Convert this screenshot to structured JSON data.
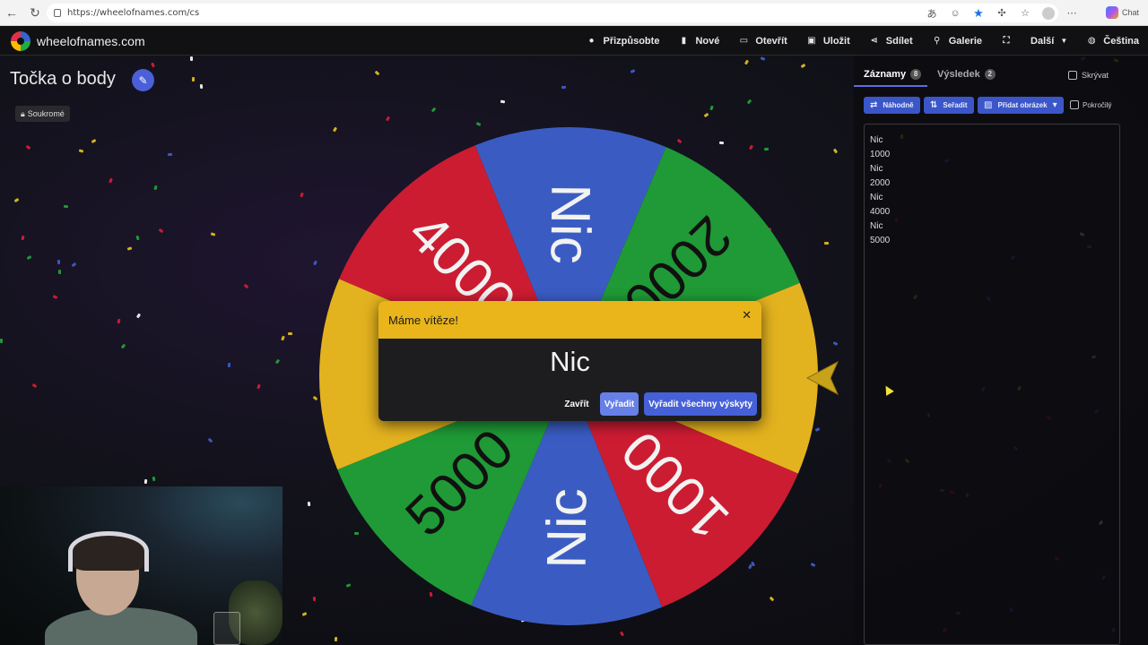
{
  "browser": {
    "url": "https://wheelofnames.com/cs",
    "chat_label": "Chat"
  },
  "site": {
    "name": "wheelofnames.com",
    "nav": [
      {
        "label": "Přizpůsobte",
        "icon": "palette-icon",
        "glyph": "●"
      },
      {
        "label": "Nové",
        "icon": "new-file-icon",
        "glyph": "▮"
      },
      {
        "label": "Otevřít",
        "icon": "folder-icon",
        "glyph": "▭"
      },
      {
        "label": "Uložit",
        "icon": "save-icon",
        "glyph": "▣"
      },
      {
        "label": "Sdílet",
        "icon": "share-icon",
        "glyph": "⋖"
      },
      {
        "label": "Galerie",
        "icon": "search-icon",
        "glyph": "⚲"
      },
      {
        "label": "",
        "icon": "fullscreen-icon",
        "glyph": "⛶"
      },
      {
        "label": "Další",
        "icon": "chevron-down-icon",
        "glyph": ""
      },
      {
        "label": "Čeština",
        "icon": "globe-icon",
        "glyph": "◍"
      }
    ]
  },
  "page": {
    "title": "Točka o body",
    "private_label": "Soukromé"
  },
  "wheel": {
    "segments": [
      {
        "label": "Nic",
        "color": "#3a5cc2"
      },
      {
        "label": "2000",
        "color": "#1f9a36"
      },
      {
        "label": "Nic",
        "color": "#e3b21f"
      },
      {
        "label": "1000",
        "color": "#cc1c32"
      },
      {
        "label": "Nic",
        "color": "#3a5cc2"
      },
      {
        "label": "5000",
        "color": "#1f9a36"
      },
      {
        "label": "Nic",
        "color": "#e3b21f"
      },
      {
        "label": "4000",
        "color": "#cc1c32"
      }
    ]
  },
  "panel": {
    "tabs": [
      {
        "label": "Záznamy",
        "count": "8"
      },
      {
        "label": "Výsledek",
        "count": "2"
      }
    ],
    "hide_label": "Skrývat",
    "toolbar": {
      "shuffle_label": "Náhodně",
      "sort_label": "Seřadit",
      "add_image_label": "Přidat obrázek",
      "advanced_label": "Pokročilý"
    },
    "entries": [
      "Nic",
      "1000",
      "Nic",
      "2000",
      "Nic",
      "4000",
      "Nic",
      "5000"
    ]
  },
  "modal": {
    "title": "Máme vítěze!",
    "winner": "Nic",
    "close_label": "Zavřít",
    "remove_label": "Vyřadit",
    "remove_all_label": "Vyřadit všechny výskyty"
  }
}
